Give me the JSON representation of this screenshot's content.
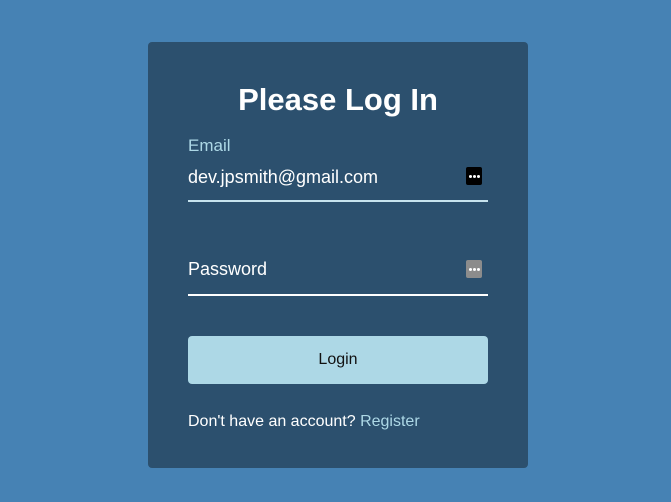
{
  "page": {
    "title": "Please Log In"
  },
  "email": {
    "label": "Email",
    "value": "dev.jpsmith@gmail.com",
    "icon": "password-manager-icon"
  },
  "password": {
    "placeholder": "Password",
    "value": "",
    "icon": "password-manager-icon"
  },
  "login": {
    "label": "Login"
  },
  "register": {
    "prompt": "Don't have an account?",
    "link_label": "Register"
  },
  "colors": {
    "background": "#4682b4",
    "card": "#2c506e",
    "accent": "#add8e6",
    "text": "#ffffff"
  }
}
